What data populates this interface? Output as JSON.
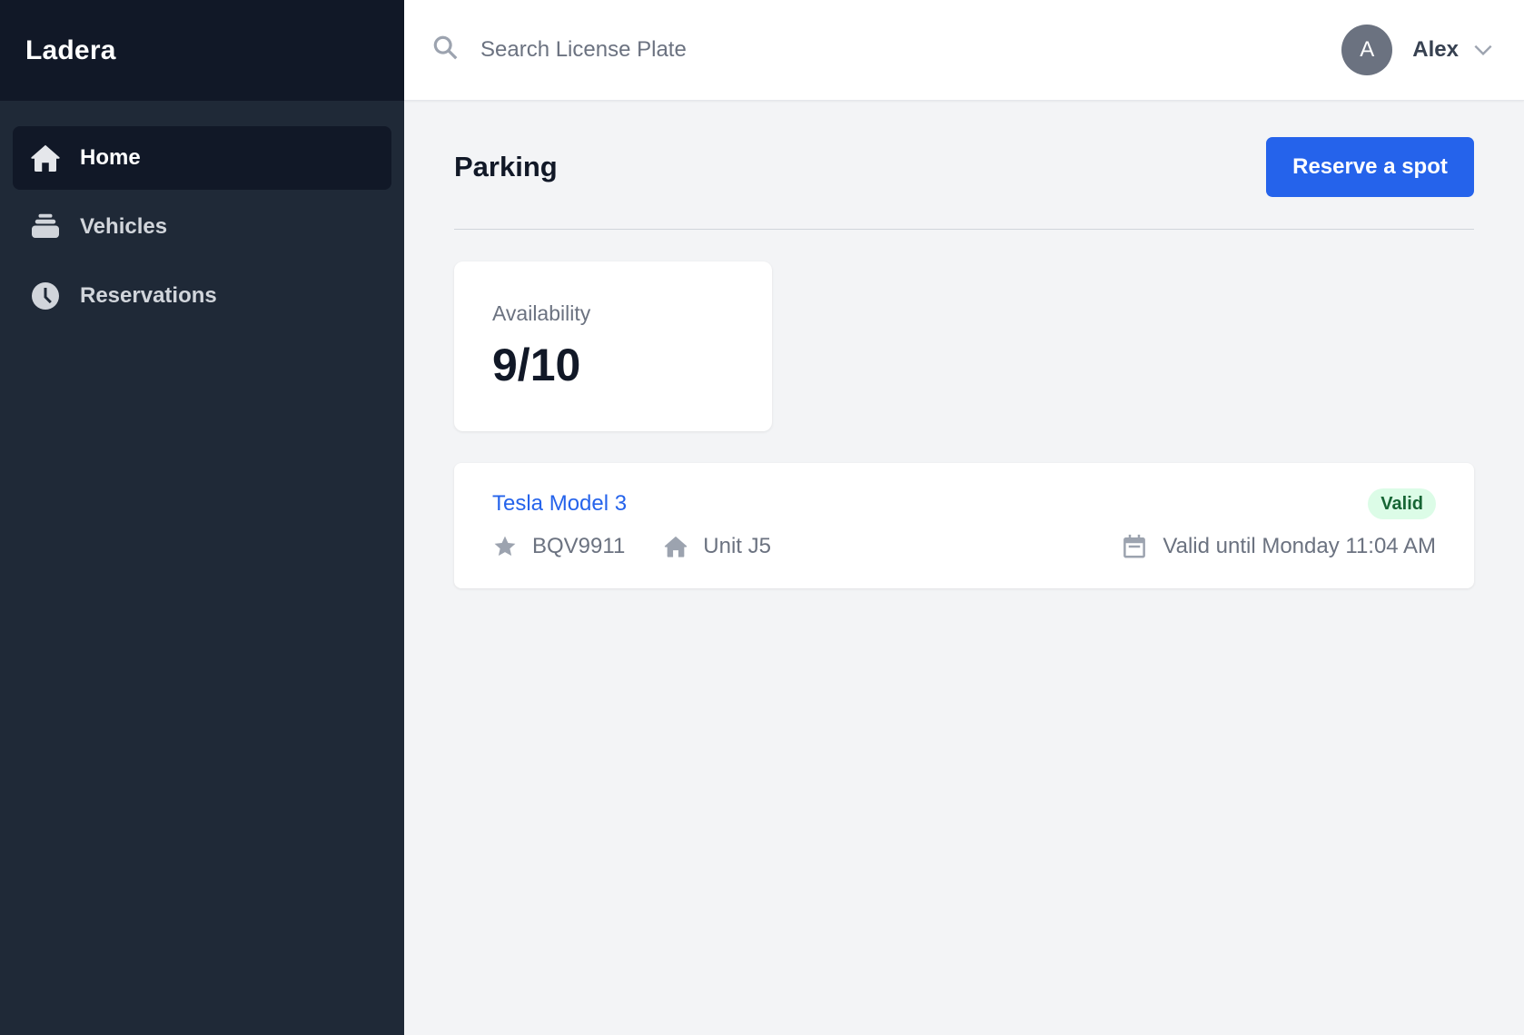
{
  "app": {
    "brand": "Ladera"
  },
  "sidebar": {
    "items": [
      {
        "label": "Home",
        "icon": "home-icon",
        "active": true
      },
      {
        "label": "Vehicles",
        "icon": "stack-icon",
        "active": false
      },
      {
        "label": "Reservations",
        "icon": "clock-icon",
        "active": false
      }
    ]
  },
  "topbar": {
    "search_placeholder": "Search License Plate",
    "search_value": "",
    "user": {
      "initial": "A",
      "name": "Alex"
    }
  },
  "page": {
    "title": "Parking",
    "primary_action": "Reserve a spot"
  },
  "stats": {
    "availability_label": "Availability",
    "availability_value": "9/10"
  },
  "reservations": [
    {
      "vehicle": "Tesla Model 3",
      "status": "Valid",
      "plate": "BQV9911",
      "unit": "Unit J5",
      "valid_until": "Valid until Monday 11:04 AM"
    }
  ],
  "colors": {
    "sidebar_bg": "#1f2937",
    "brand_bg": "#111827",
    "accent": "#2563eb",
    "status_valid_bg": "#dcfce7",
    "status_valid_text": "#166534"
  }
}
